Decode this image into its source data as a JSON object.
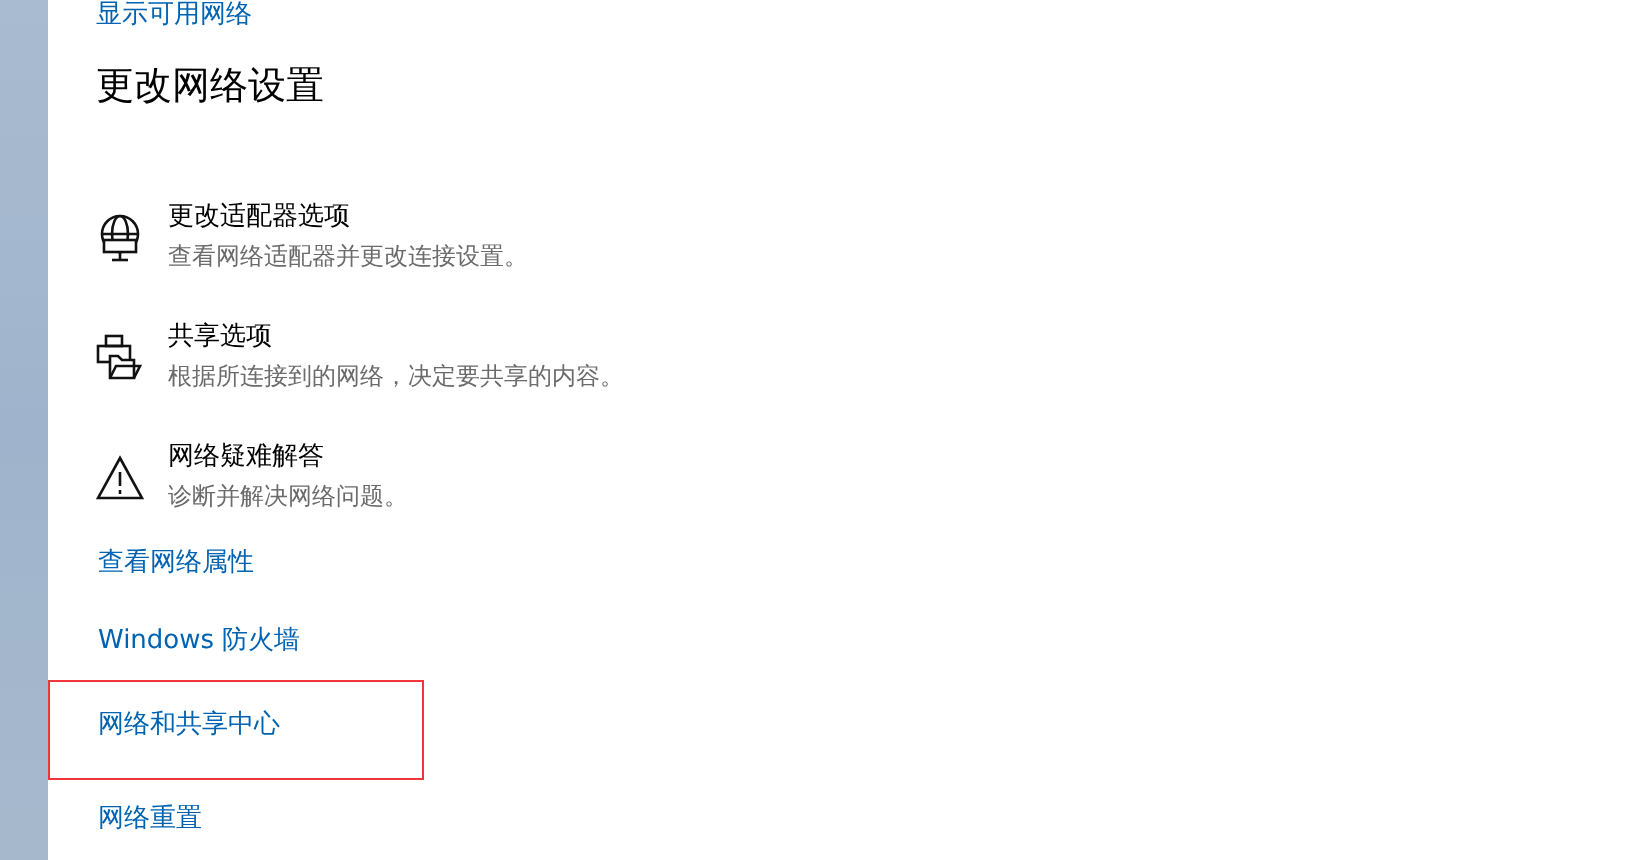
{
  "top_link": "显示可用网络",
  "section": {
    "title": "更改网络设置"
  },
  "options": [
    {
      "kind": "globe",
      "title": "更改适配器选项",
      "description": "查看网络适配器并更改连接设置。"
    },
    {
      "kind": "share",
      "title": "共享选项",
      "description": "根据所连接到的网络，决定要共享的内容。"
    },
    {
      "kind": "warning",
      "title": "网络疑难解答",
      "description": "诊断并解决网络问题。"
    }
  ],
  "links": [
    {
      "label": "查看网络属性",
      "highlighted": false
    },
    {
      "label": "Windows 防火墙",
      "highlighted": false
    },
    {
      "label": "网络和共享中心",
      "highlighted": true
    },
    {
      "label": "网络重置",
      "highlighted": false
    }
  ]
}
